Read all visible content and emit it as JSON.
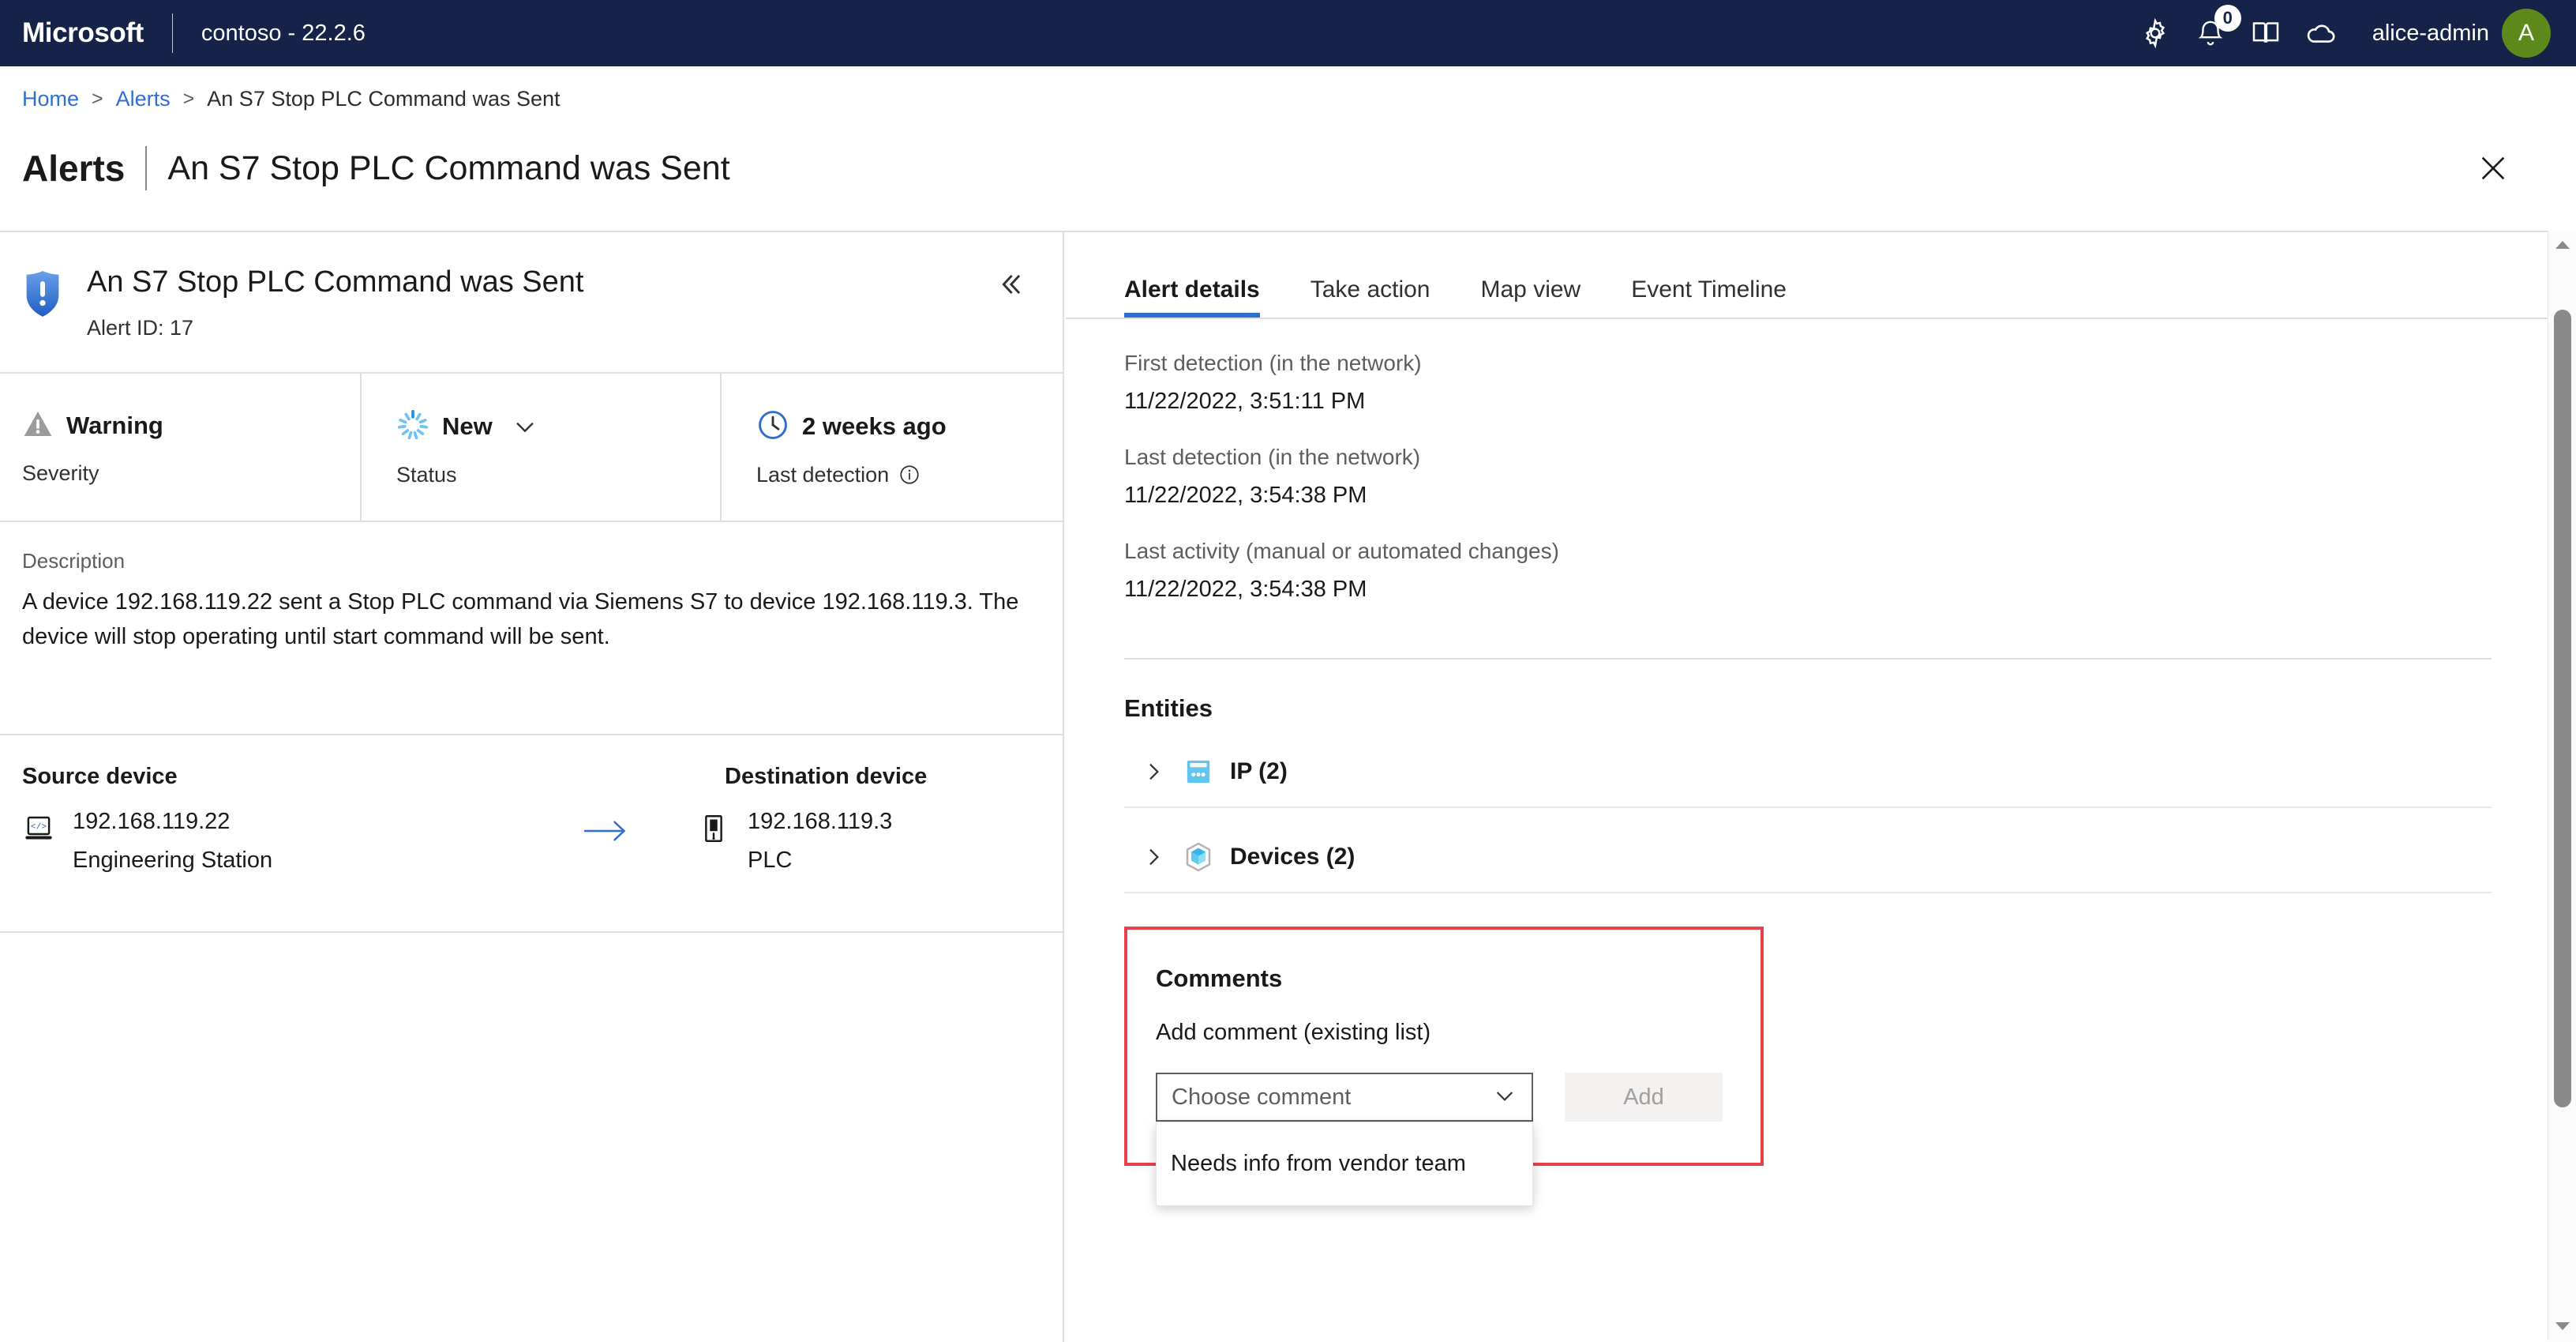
{
  "topbar": {
    "logo": "Microsoft",
    "tenant": "contoso - 22.2.6",
    "icons": [
      {
        "name": "gear-icon",
        "label": "Settings"
      },
      {
        "name": "bell-icon",
        "label": "Notifications",
        "badge": "0"
      },
      {
        "name": "book-icon",
        "label": "Documentation"
      },
      {
        "name": "cloud-icon",
        "label": "Cloud"
      }
    ],
    "username": "alice-admin",
    "avatar_initial": "A",
    "avatar_color": "#5c8a1b",
    "bar_color": "#142347"
  },
  "breadcrumb": {
    "home": "Home",
    "sep": ">",
    "alerts": "Alerts",
    "current": "An S7 Stop PLC Command was Sent"
  },
  "page": {
    "title": "Alerts",
    "subtitle": "An S7 Stop PLC Command was Sent",
    "close_label": "Close"
  },
  "alert": {
    "name": "An S7 Stop PLC Command was Sent",
    "id_label": "Alert ID: 17",
    "collapse_label": "Collapse",
    "severity": {
      "value": "Warning",
      "label": "Severity"
    },
    "status": {
      "value": "New",
      "label": "Status"
    },
    "last_detection": {
      "value": "2 weeks ago",
      "label": "Last detection"
    },
    "description": {
      "label": "Description",
      "text": "A device 192.168.119.22 sent a Stop PLC command via Siemens S7 to device 192.168.119.3. The device will stop operating until start command will be sent."
    },
    "source_device": {
      "heading": "Source device",
      "ip": "192.168.119.22",
      "type": "Engineering Station"
    },
    "destination_device": {
      "heading": "Destination device",
      "ip": "192.168.119.3",
      "type": "PLC"
    }
  },
  "tabs": [
    {
      "label": "Alert details",
      "active": true
    },
    {
      "label": "Take action",
      "active": false
    },
    {
      "label": "Map view",
      "active": false
    },
    {
      "label": "Event Timeline",
      "active": false
    }
  ],
  "details": {
    "first_detection": {
      "label": "First detection (in the network)",
      "value": "11/22/2022, 3:51:11 PM"
    },
    "last_detection": {
      "label": "Last detection (in the network)",
      "value": "11/22/2022, 3:54:38 PM"
    },
    "last_activity": {
      "label": "Last activity (manual or automated changes)",
      "value": "11/22/2022, 3:54:38 PM"
    }
  },
  "entities": {
    "title": "Entities",
    "rows": [
      {
        "label": "IP (2)",
        "icon": "ip-entity-icon"
      },
      {
        "label": "Devices (2)",
        "icon": "device-entity-icon"
      }
    ]
  },
  "comments": {
    "title": "Comments",
    "subtitle": "Add comment (existing list)",
    "select_placeholder": "Choose comment",
    "add_button": "Add",
    "options": [
      "Needs info from vendor team"
    ],
    "highlight_color": "#e8414a"
  },
  "accent_color": "#2f6fd0"
}
